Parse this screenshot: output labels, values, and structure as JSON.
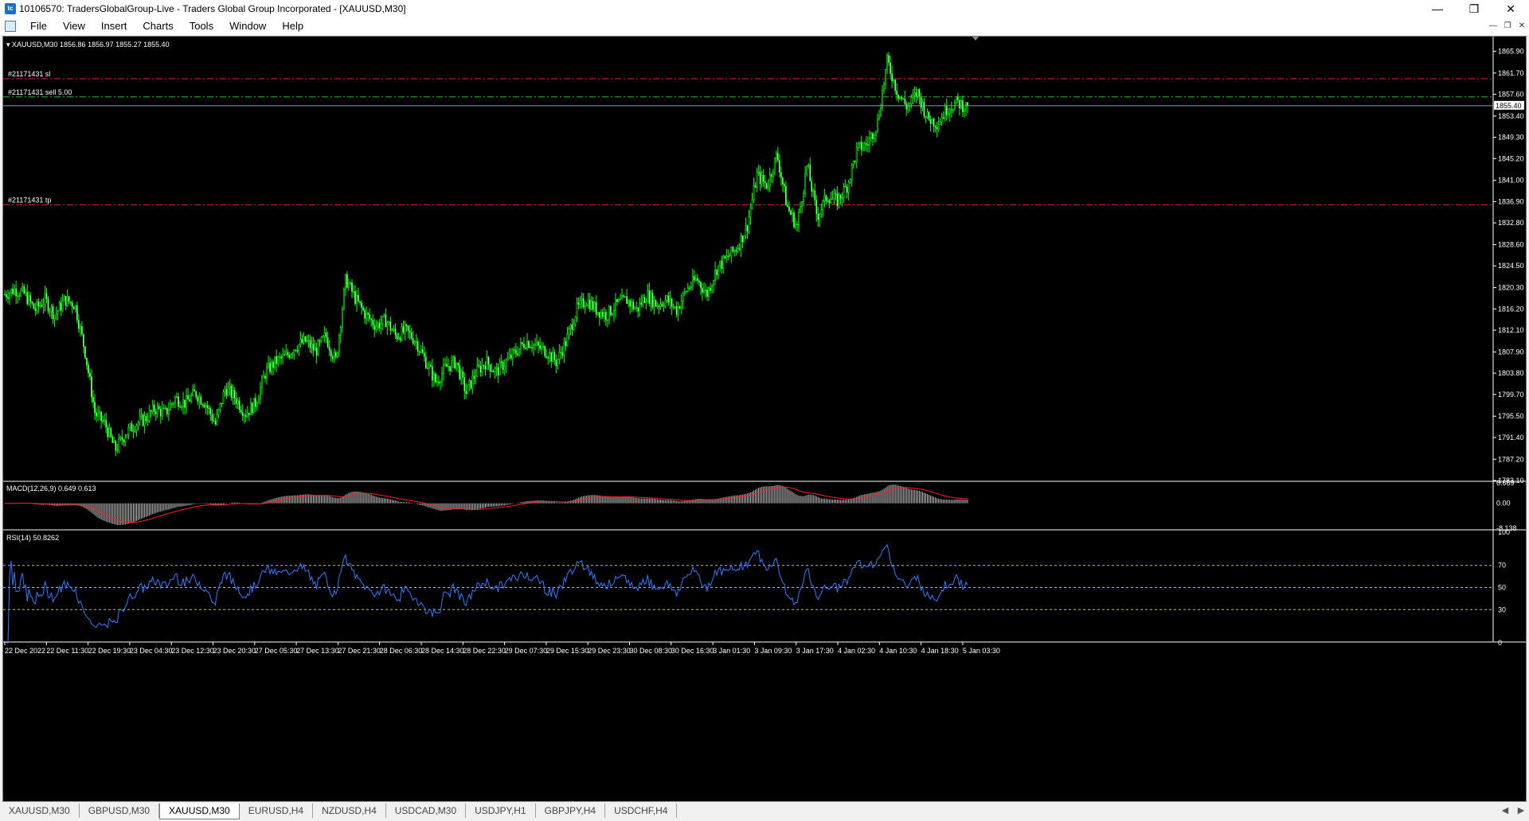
{
  "window": {
    "title": "10106570: TradersGlobalGroup-Live - Traders Global Group Incorporated - [XAUUSD,M30]",
    "app_icon": "metatrader-icon",
    "controls": [
      "minimize",
      "maximize",
      "close"
    ]
  },
  "menu": {
    "items": [
      "File",
      "View",
      "Insert",
      "Charts",
      "Tools",
      "Window",
      "Help"
    ]
  },
  "chart": {
    "header": "XAUUSD,M30  1856.86 1856.97 1855.27 1855.40",
    "current_price": "1855.40",
    "order_lines": [
      {
        "label": "#21171431 sl",
        "price": 1860.6,
        "color": "#d42a2a"
      },
      {
        "label": "#21171431 sell 5.00",
        "price": 1857.1,
        "color": "#2bb52b"
      },
      {
        "label": "#21171431 tp",
        "price": 1836.3,
        "color": "#d42a2a"
      }
    ],
    "colors": {
      "background": "#000000",
      "candle": "#00ff00",
      "bid_line": "#8c9bad",
      "axis_text": "#ffffff"
    }
  },
  "chart_data": [
    {
      "type": "candlestick",
      "title": "XAUUSD,M30",
      "ylim": [
        1783.1,
        1867.5
      ],
      "yticks": [
        "1865.90",
        "1861.70",
        "1857.60",
        "1853.40",
        "1849.30",
        "1845.20",
        "1841.00",
        "1836.90",
        "1832.80",
        "1828.60",
        "1824.50",
        "1820.30",
        "1816.20",
        "1812.10",
        "1807.90",
        "1803.80",
        "1799.70",
        "1795.50",
        "1791.40",
        "1787.20",
        "1783.10"
      ],
      "xticks": [
        "22 Dec 2022",
        "22 Dec 11:30",
        "22 Dec 19:30",
        "23 Dec 04:30",
        "23 Dec 12:30",
        "23 Dec 20:30",
        "27 Dec 05:30",
        "27 Dec 13:30",
        "27 Dec 21:30",
        "28 Dec 06:30",
        "28 Dec 14:30",
        "28 Dec 22:30",
        "29 Dec 07:30",
        "29 Dec 15:30",
        "29 Dec 23:30",
        "30 Dec 08:30",
        "30 Dec 16:30",
        "3 Jan 01:30",
        "3 Jan 09:30",
        "3 Jan 17:30",
        "4 Jan 02:30",
        "4 Jan 10:30",
        "4 Jan 18:30",
        "5 Jan 03:30"
      ],
      "close_path": [
        1819,
        1820,
        1819,
        1816,
        1818,
        1815,
        1818,
        1817,
        1808,
        1796,
        1794,
        1789,
        1792,
        1794,
        1795,
        1797,
        1796,
        1799,
        1798,
        1800,
        1798,
        1794,
        1801,
        1799,
        1796,
        1798,
        1804,
        1806,
        1807,
        1809,
        1810,
        1808,
        1811,
        1806,
        1822,
        1818,
        1815,
        1813,
        1814,
        1811,
        1812,
        1810,
        1806,
        1802,
        1805,
        1806,
        1800,
        1804,
        1806,
        1804,
        1806,
        1808,
        1810,
        1809,
        1808,
        1806,
        1810,
        1816,
        1818,
        1816,
        1815,
        1817,
        1818,
        1816,
        1819,
        1817,
        1818,
        1816,
        1820,
        1822,
        1819,
        1824,
        1826,
        1828,
        1832,
        1842,
        1840,
        1846,
        1836,
        1832,
        1844,
        1834,
        1838,
        1837,
        1840,
        1847,
        1848,
        1852,
        1864,
        1858,
        1855,
        1858,
        1853,
        1852,
        1855,
        1856,
        1855
      ],
      "current": 1855.4
    },
    {
      "type": "bar",
      "title": "MACD(12,26,9) 0.649 0.613",
      "series": [
        {
          "name": "MACD(12,26,9)",
          "last": 0.649
        },
        {
          "name": "Signal",
          "last": 0.613
        }
      ],
      "ylim": [
        -8.138,
        6.669
      ],
      "yticks": [
        "6.669",
        "0.00",
        "-8.138"
      ]
    },
    {
      "type": "line",
      "title": "RSI(14) 50.8262",
      "series": [
        {
          "name": "RSI(14)",
          "last": 50.8262
        }
      ],
      "ylim": [
        0,
        100
      ],
      "yticks": [
        "100",
        "70",
        "50",
        "30",
        "0"
      ],
      "levels": [
        70,
        50,
        30
      ]
    }
  ],
  "tabs": {
    "items": [
      "XAUUSD,M30",
      "GBPUSD,M30",
      "XAUUSD,M30",
      "EURUSD,H4",
      "NZDUSD,H4",
      "USDCAD,M30",
      "USDJPY,H1",
      "GBPJPY,H4",
      "USDCHF,H4"
    ],
    "active_index": 2
  }
}
